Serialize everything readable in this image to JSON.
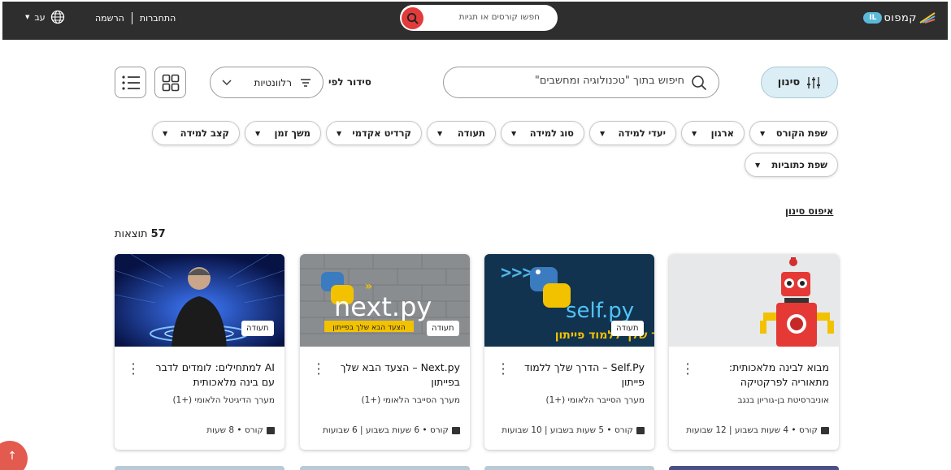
{
  "header": {
    "logo_badge": "IL",
    "logo_text": "קמפוס",
    "search_placeholder": "חפשו קורסים או תגיות",
    "login": "התחברות",
    "register": "הרשמה",
    "language": "עב"
  },
  "controls": {
    "filter_label": "סינון",
    "search_placeholder": "חיפוש בתוך \"טכנולוגיה ומחשבים\"",
    "sort_label": "סידור לפי",
    "sort_value": "רלוונטיות"
  },
  "filters": [
    "שפת הקורס",
    "ארגון",
    "יעדי למידה",
    "סוג למידה",
    "תעודה",
    "קרדיט אקדמי",
    "משך זמן",
    "קצב למידה",
    "שפת כתוביות"
  ],
  "reset_label": "איפוס סינון",
  "results": {
    "count": "57",
    "label": "תוצאות"
  },
  "cards": [
    {
      "badge": "",
      "title": "מבוא לבינה מלאכותית: מתאוריה לפרקטיקה",
      "org": "אוניברסיטת בן-גוריון בנגב",
      "meta": "קורס • 4 שעות בשבוע | 12 שבועות"
    },
    {
      "badge": "תעודה",
      "title": "Self.Py – הדרך שלך ללמוד פייתון",
      "org": "מערך הסייבר הלאומי (+1)",
      "meta": "קורס • 5 שעות בשבוע | 10 שבועות",
      "image_text": "self.py",
      "image_sub": "ך שלך ללמוד פייתון"
    },
    {
      "badge": "תעודה",
      "title": "Next.py – הצעד הבא שלך בפייתון",
      "org": "מערך הסייבר הלאומי (+1)",
      "meta": "קורס • 6 שעות בשבוע | 6 שבועות",
      "image_text": "next.py",
      "image_sub": "הצעד הבא שלך בפייתון"
    },
    {
      "badge": "תעודה",
      "title": "AI למתחילים: לומדים לדבר עם בינה מלאכותית",
      "org": "מערך הדיגיטל הלאומי (+1)",
      "meta": "קורס • 8 שעות"
    }
  ],
  "colors": {
    "topbar": "#2e2e2e",
    "accent_red": "#e23b3b",
    "filter_bg": "#dceef5",
    "logo_blue": "#5bb8d8"
  }
}
